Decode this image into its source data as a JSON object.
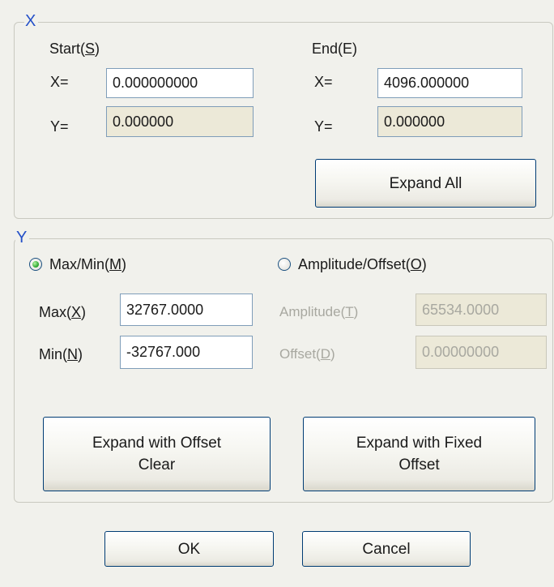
{
  "colors": {
    "background": "#f1f1ec",
    "group_title": "#2450c8",
    "field_border": "#7f9db9",
    "readonly_field": "#ece9d8",
    "disabled_text": "#a8a8a0",
    "radio_selected": "#22a128"
  },
  "x_group": {
    "title": "X",
    "start": {
      "label": "Start(",
      "mnemonic": "S",
      "label_end": ")",
      "x_label": "X=",
      "x_value": "0.000000000",
      "y_label": "Y=",
      "y_value": "0.000000"
    },
    "end": {
      "label": "End(E)",
      "x_label": "X=",
      "x_value": "4096.000000",
      "y_label": "Y=",
      "y_value": "0.000000"
    },
    "expand_all_label": "Expand All"
  },
  "y_group": {
    "title": "Y",
    "mode_maxmin": {
      "label": "Max/Min(",
      "mnemonic": "M",
      "label_end": ")",
      "selected": true
    },
    "mode_amplitude": {
      "label": "Amplitude/Offset(",
      "mnemonic": "O",
      "label_end": ")",
      "selected": false
    },
    "max": {
      "label": "Max(",
      "mnemonic": "X",
      "label_end": ")",
      "value": "32767.0000"
    },
    "min": {
      "label": "Min(",
      "mnemonic": "N",
      "label_end": ")",
      "value": "-32767.000"
    },
    "amplitude": {
      "label": "Amplitude(",
      "mnemonic": "T",
      "label_end": ")",
      "value": "65534.0000"
    },
    "offset": {
      "label": "Offset(",
      "mnemonic": "D",
      "label_end": ")",
      "value": "0.00000000"
    },
    "expand_offset_clear": {
      "line1": "Expand with Offset",
      "line2": "Clear"
    },
    "expand_fixed_offset": {
      "line1": "Expand with Fixed",
      "line2": "Offset"
    }
  },
  "footer": {
    "ok_label": "OK",
    "cancel_label": "Cancel"
  }
}
